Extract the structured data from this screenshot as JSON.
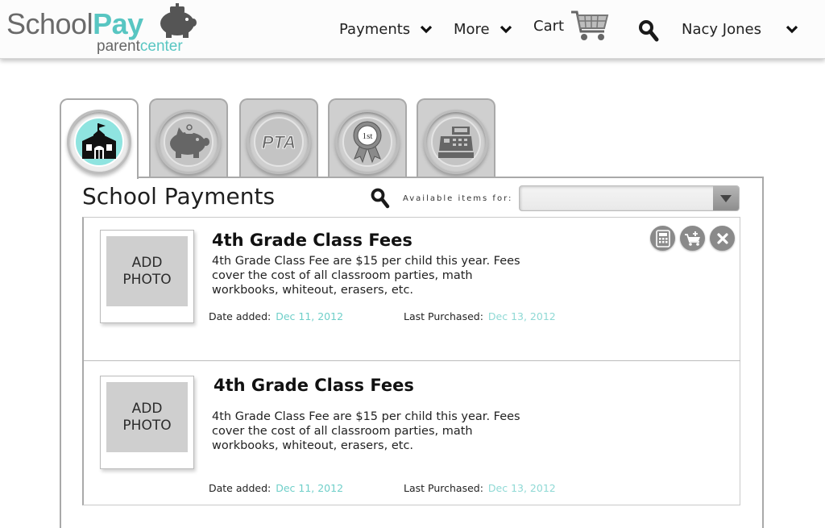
{
  "header": {
    "logo": {
      "school": "School",
      "pay": "Pay",
      "sub_parent": "parent",
      "sub_center": "center"
    },
    "nav": {
      "payments": "Payments",
      "more": "More",
      "cart": "Cart",
      "user": "Nacy Jones"
    }
  },
  "tabs": [
    {
      "name": "school",
      "icon": "school-house-icon",
      "active": true
    },
    {
      "name": "savings",
      "icon": "piggy-bank-icon",
      "active": false
    },
    {
      "name": "pta",
      "icon": "pta-icon",
      "label": "PTA",
      "active": false
    },
    {
      "name": "awards",
      "icon": "ribbon-award-icon",
      "label": "1st",
      "active": false
    },
    {
      "name": "register",
      "icon": "cash-register-icon",
      "active": false
    }
  ],
  "panel": {
    "title": "School Payments",
    "available_label": "Available items for:",
    "filter_value": ""
  },
  "items": [
    {
      "photo_line1": "ADD",
      "photo_line2": "PHOTO",
      "name": "4th Grade Class Fees",
      "description": "4th Grade Class Fee are $15 per child this year. Fees cover the cost of all classroom parties, math workbooks, whiteout, erasers, etc.",
      "date_added_label": "Date added:",
      "date_added": "Dec 11, 2012",
      "last_purchased_label": "Last Purchased:",
      "last_purchased": "Dec 13, 2012"
    },
    {
      "photo_line1": "ADD",
      "photo_line2": "PHOTO",
      "name": "4th Grade Class Fees",
      "description": "4th Grade Class Fee are $15 per child this year. Fees cover the cost of all classroom parties, math workbooks, whiteout, erasers, etc.",
      "date_added_label": "Date added:",
      "date_added": "Dec 11, 2012",
      "last_purchased_label": "Last Purchased:",
      "last_purchased": "Dec 13, 2012"
    }
  ],
  "colors": {
    "accent": "#58c6c2",
    "date_value": "#6fcfc9",
    "tab_inactive": "#cfcfcf",
    "active_badge": "#8fe4e0"
  }
}
